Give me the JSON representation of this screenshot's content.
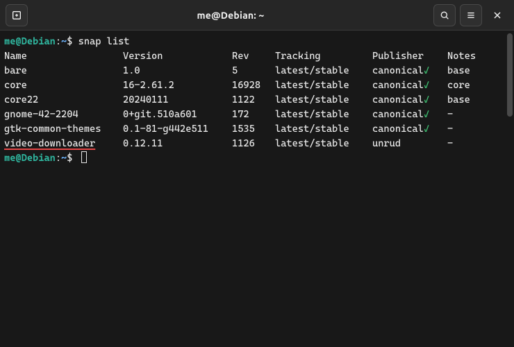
{
  "titlebar": {
    "title": "me@Debian: ~"
  },
  "prompt": {
    "user": "me",
    "at": "@",
    "host": "Debian",
    "colon": ":",
    "path": "~",
    "dollar": "$ "
  },
  "command1": "snap list",
  "headers": {
    "name": "Name",
    "version": "Version",
    "rev": "Rev",
    "tracking": "Tracking",
    "publisher": "Publisher",
    "notes": "Notes"
  },
  "checkmark": "✓",
  "rows": [
    {
      "name": "bare",
      "version": "1.0",
      "rev": "5",
      "tracking": "latest/stable",
      "publisher": "canonical",
      "verified": true,
      "notes": "base"
    },
    {
      "name": "core",
      "version": "16-2.61.2",
      "rev": "16928",
      "tracking": "latest/stable",
      "publisher": "canonical",
      "verified": true,
      "notes": "core"
    },
    {
      "name": "core22",
      "version": "20240111",
      "rev": "1122",
      "tracking": "latest/stable",
      "publisher": "canonical",
      "verified": true,
      "notes": "base"
    },
    {
      "name": "gnome-42-2204",
      "version": "0+git.510a601",
      "rev": "172",
      "tracking": "latest/stable",
      "publisher": "canonical",
      "verified": true,
      "notes": "-"
    },
    {
      "name": "gtk-common-themes",
      "version": "0.1-81-g442e511",
      "rev": "1535",
      "tracking": "latest/stable",
      "publisher": "canonical",
      "verified": true,
      "notes": "-"
    },
    {
      "name": "video-downloader",
      "version": "0.12.11",
      "rev": "1126",
      "tracking": "latest/stable",
      "publisher": "unrud",
      "verified": false,
      "notes": "-",
      "highlight": true
    }
  ],
  "highlight_row_name": "video-downloader"
}
